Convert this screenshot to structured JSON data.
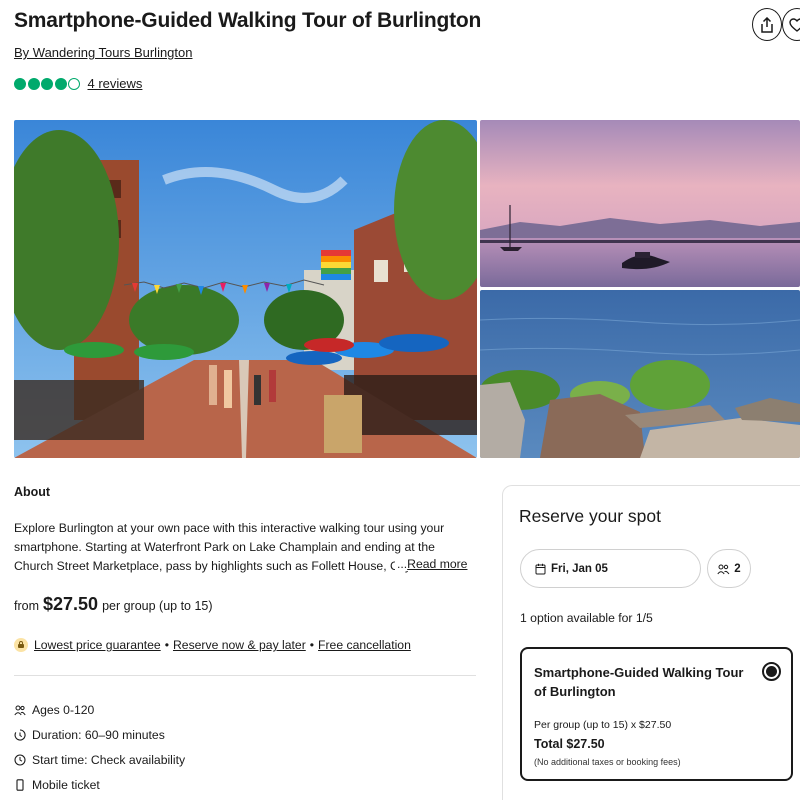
{
  "header": {
    "title": "Smartphone-Guided Walking Tour of Burlington",
    "byline": "By Wandering Tours Burlington",
    "rating_bubbles": 4,
    "rating_max": 5,
    "reviews_label": "4 reviews",
    "share_icon": "share-icon",
    "save_icon": "heart-icon"
  },
  "about": {
    "heading": "About",
    "text": "Explore Burlington at your own pace with this interactive walking tour using your smartphone. Starting at Waterfront Park on Lake Champlain and ending at the Church Street Marketplace, pass by highlights such as Follett House, City Hall Park",
    "read_more_prefix": "...",
    "read_more": "Read more"
  },
  "price": {
    "from": "from",
    "amount": "$27.50",
    "unit": "per group (up to 15)"
  },
  "perks": [
    "Lowest price guarantee",
    "Reserve now & pay later",
    "Free cancellation"
  ],
  "perk_separator": "•",
  "features": [
    {
      "icon": "group-icon",
      "label": "Ages 0-120"
    },
    {
      "icon": "timer-icon",
      "label": "Duration: 60–90 minutes"
    },
    {
      "icon": "clock-icon",
      "label": "Start time: Check availability"
    },
    {
      "icon": "mobile-icon",
      "label": "Mobile ticket"
    }
  ],
  "reserve": {
    "heading": "Reserve your spot",
    "date": "Fri, Jan 05",
    "travelers": "2",
    "options_count": "1 option available for 1/5",
    "option": {
      "title": "Smartphone-Guided Walking Tour of Burlington",
      "per_group": "Per group (up to 15) x $27.50",
      "total": "Total $27.50",
      "note": "(No additional taxes or booking fees)",
      "selected": true
    }
  },
  "colors": {
    "rating": "#00aa6c",
    "perk_badge": "#fbe3a5",
    "text": "#1a1a1a",
    "border": "#e0e0e0"
  }
}
